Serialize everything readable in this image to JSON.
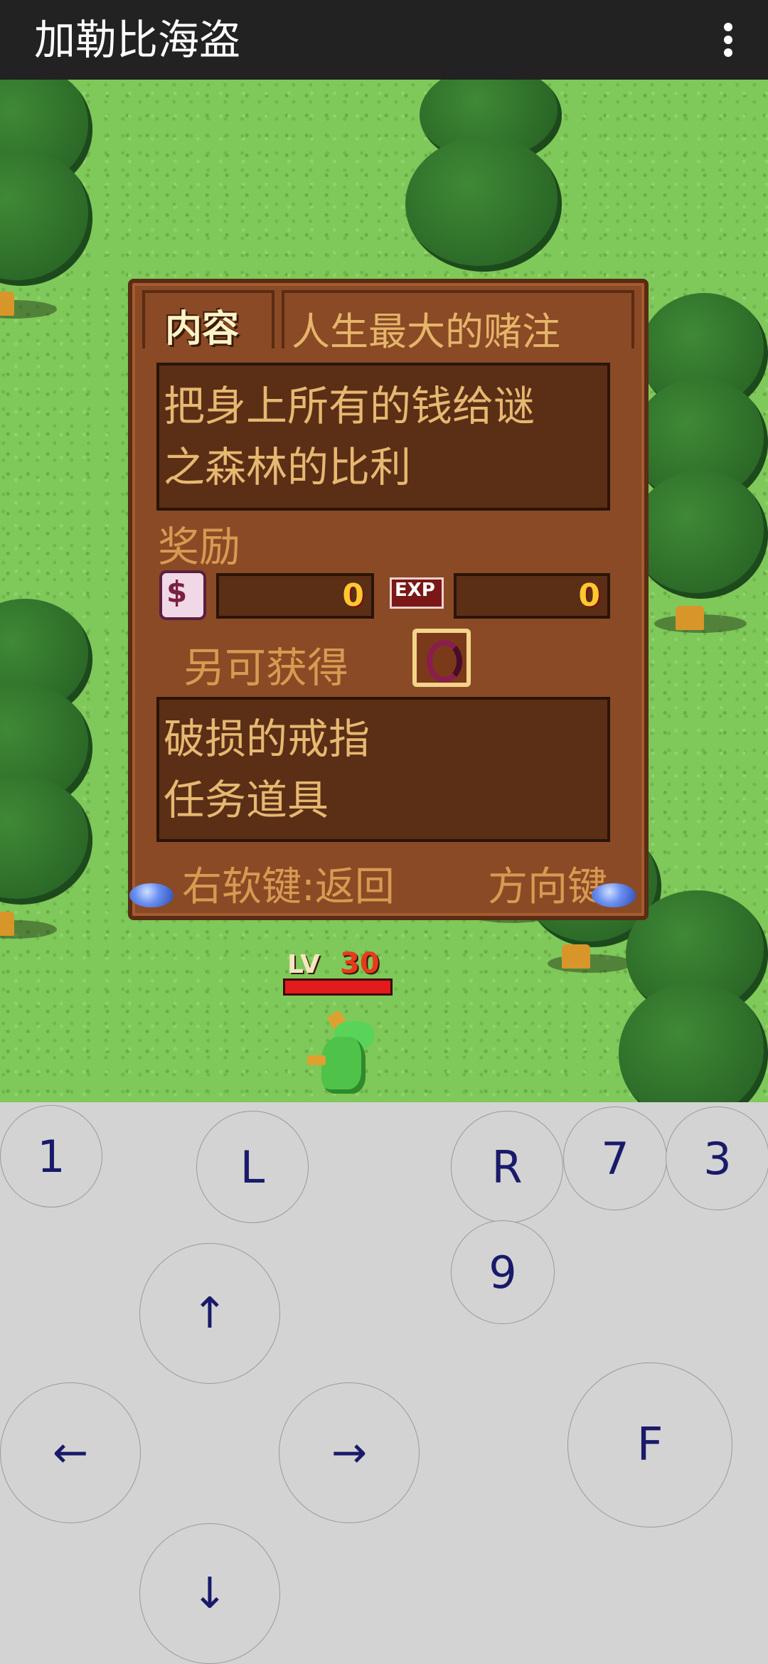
{
  "app": {
    "title": "加勒比海盗",
    "menu_icon": "more-vert-icon"
  },
  "quest_panel": {
    "tab_label": "内容",
    "quest_title": "人生最大的赌注",
    "description_lines": [
      "把身上所有的钱给谜",
      "之森林的比利"
    ],
    "reward_label": "奖励",
    "money_icon_text": "$",
    "money_value": "0",
    "exp_label": "EXP",
    "exp_value": "0",
    "extra_label": "另可获得",
    "item_lines": [
      "破损的戒指",
      "任务道具"
    ],
    "footer_left": "右软键:返回",
    "footer_right": "方向键"
  },
  "hero": {
    "level_label": "LV",
    "level": "30"
  },
  "keypad": {
    "buttons": {
      "k1": "1",
      "kL": "L",
      "kR": "R",
      "k7": "7",
      "k3": "3",
      "k9": "9",
      "up": "↑",
      "left": "←",
      "right": "→",
      "down": "↓",
      "F": "F"
    }
  },
  "colors": {
    "appbar": "#222222",
    "panel": "#8a4a25",
    "pad": "#d3d3d3",
    "key_text": "#1a1a6a",
    "grass": "#7fc85a"
  }
}
